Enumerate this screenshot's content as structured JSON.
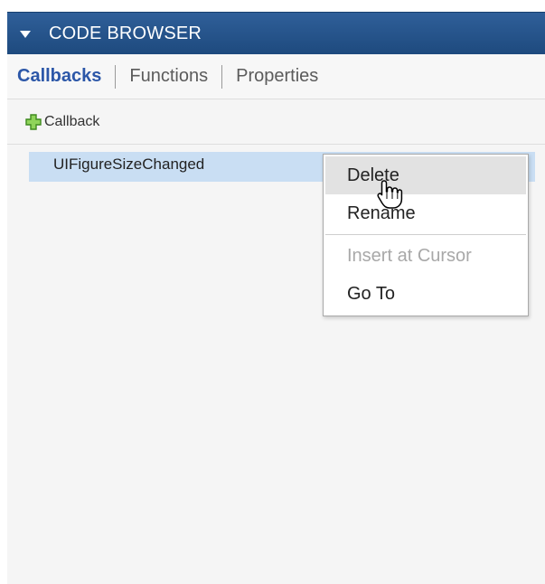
{
  "panel": {
    "title": "CODE BROWSER",
    "header_color": "#2a5893"
  },
  "tabs": [
    {
      "label": "Callbacks",
      "active": true
    },
    {
      "label": "Functions",
      "active": false
    },
    {
      "label": "Properties",
      "active": false
    }
  ],
  "toolbar": {
    "add_label": "Callback",
    "add_icon": "plus-icon",
    "add_icon_color": "#5fb030"
  },
  "list": {
    "items": [
      {
        "label": "UIFigureSizeChanged",
        "selected": true
      }
    ]
  },
  "context_menu": {
    "items": [
      {
        "label": "Delete",
        "state": "hover"
      },
      {
        "label": "Rename",
        "state": "normal"
      },
      {
        "label": "Insert at Cursor",
        "state": "disabled"
      },
      {
        "label": "Go To",
        "state": "normal"
      }
    ]
  },
  "colors": {
    "active_tab": "#2c57a8",
    "selected_row": "#c9def3",
    "menu_hover": "#e2e2e2"
  }
}
